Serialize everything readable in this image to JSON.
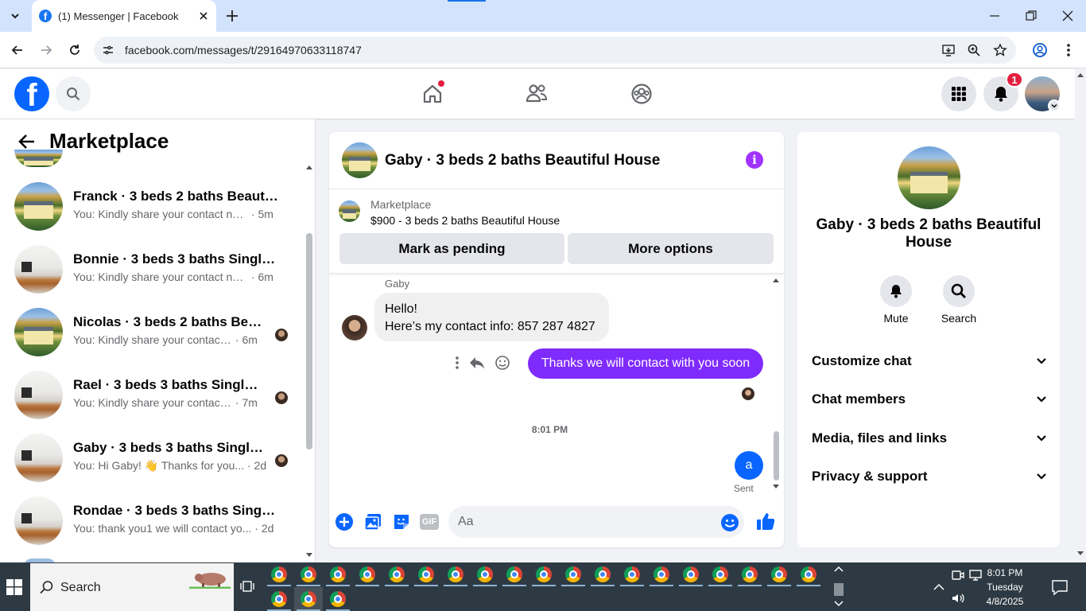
{
  "browser": {
    "tab_title": "(1) Messenger | Facebook",
    "favicon_letter": "f",
    "url": "facebook.com/messages/t/29164970633118747"
  },
  "header": {
    "logo_letter": "f",
    "notification_count": "1"
  },
  "sidebar": {
    "title": "Marketplace",
    "conversations": [
      {
        "name": "Franck · 3 beds 2 baths Beautiful House",
        "snippet": "You: Kindly share your contact num...",
        "time": "· 5m",
        "thumb": "house",
        "seen_avatar": false
      },
      {
        "name": "Bonnie · 3 beds 3 baths Single Family",
        "snippet": "You: Kindly share your contact num...",
        "time": "· 6m",
        "thumb": "room",
        "seen_avatar": false
      },
      {
        "name": "Nicolas · 3 beds 2 baths Beautiful House",
        "snippet": "You: Kindly share your contact n...",
        "time": "· 6m",
        "thumb": "house",
        "seen_avatar": true
      },
      {
        "name": "Rael · 3 beds 3 baths Single Family",
        "snippet": "You: Kindly share your contact n...",
        "time": "· 7m",
        "thumb": "room",
        "seen_avatar": true
      },
      {
        "name": "Gaby · 3 beds 3 baths Single Family",
        "snippet": "You: Hi Gaby! 👋 Thanks for you...",
        "time": "· 2d",
        "thumb": "room",
        "seen_avatar": true
      },
      {
        "name": "Rondae · 3 beds 3 baths Single Family",
        "snippet": "You: thank you1 we will contact yo...",
        "time": "· 2d",
        "thumb": "room",
        "seen_avatar": false
      }
    ]
  },
  "chat": {
    "title": "Gaby · 3 beds 2 baths Beautiful House",
    "marketplace_label": "Marketplace",
    "listing": "$900 - 3 beds 2 baths Beautiful House",
    "mark_pending": "Mark as pending",
    "more_options": "More options",
    "sender_name": "Gaby",
    "incoming_line1": "Hello!",
    "incoming_line2": "Here’s my contact info: 857 287 4827",
    "outgoing": "Thanks we will contact with you soon",
    "timestamp": "8:01 PM",
    "last_message": "a",
    "status": "Sent",
    "composer_placeholder": "Aa",
    "gif_label": "GIF"
  },
  "details": {
    "name": "Gaby · 3 beds 2 baths Beautiful House",
    "mute_label": "Mute",
    "search_label": "Search",
    "sections": [
      "Customize chat",
      "Chat members",
      "Media, files and links",
      "Privacy & support"
    ]
  },
  "taskbar": {
    "search_label": "Search",
    "time": "8:01 PM",
    "day": "Tuesday",
    "date": "4/8/2025"
  },
  "colors": {
    "facebook_blue": "#0866ff",
    "messenger_purple": "#7f2bfd",
    "notification_red": "#e41e3f"
  }
}
